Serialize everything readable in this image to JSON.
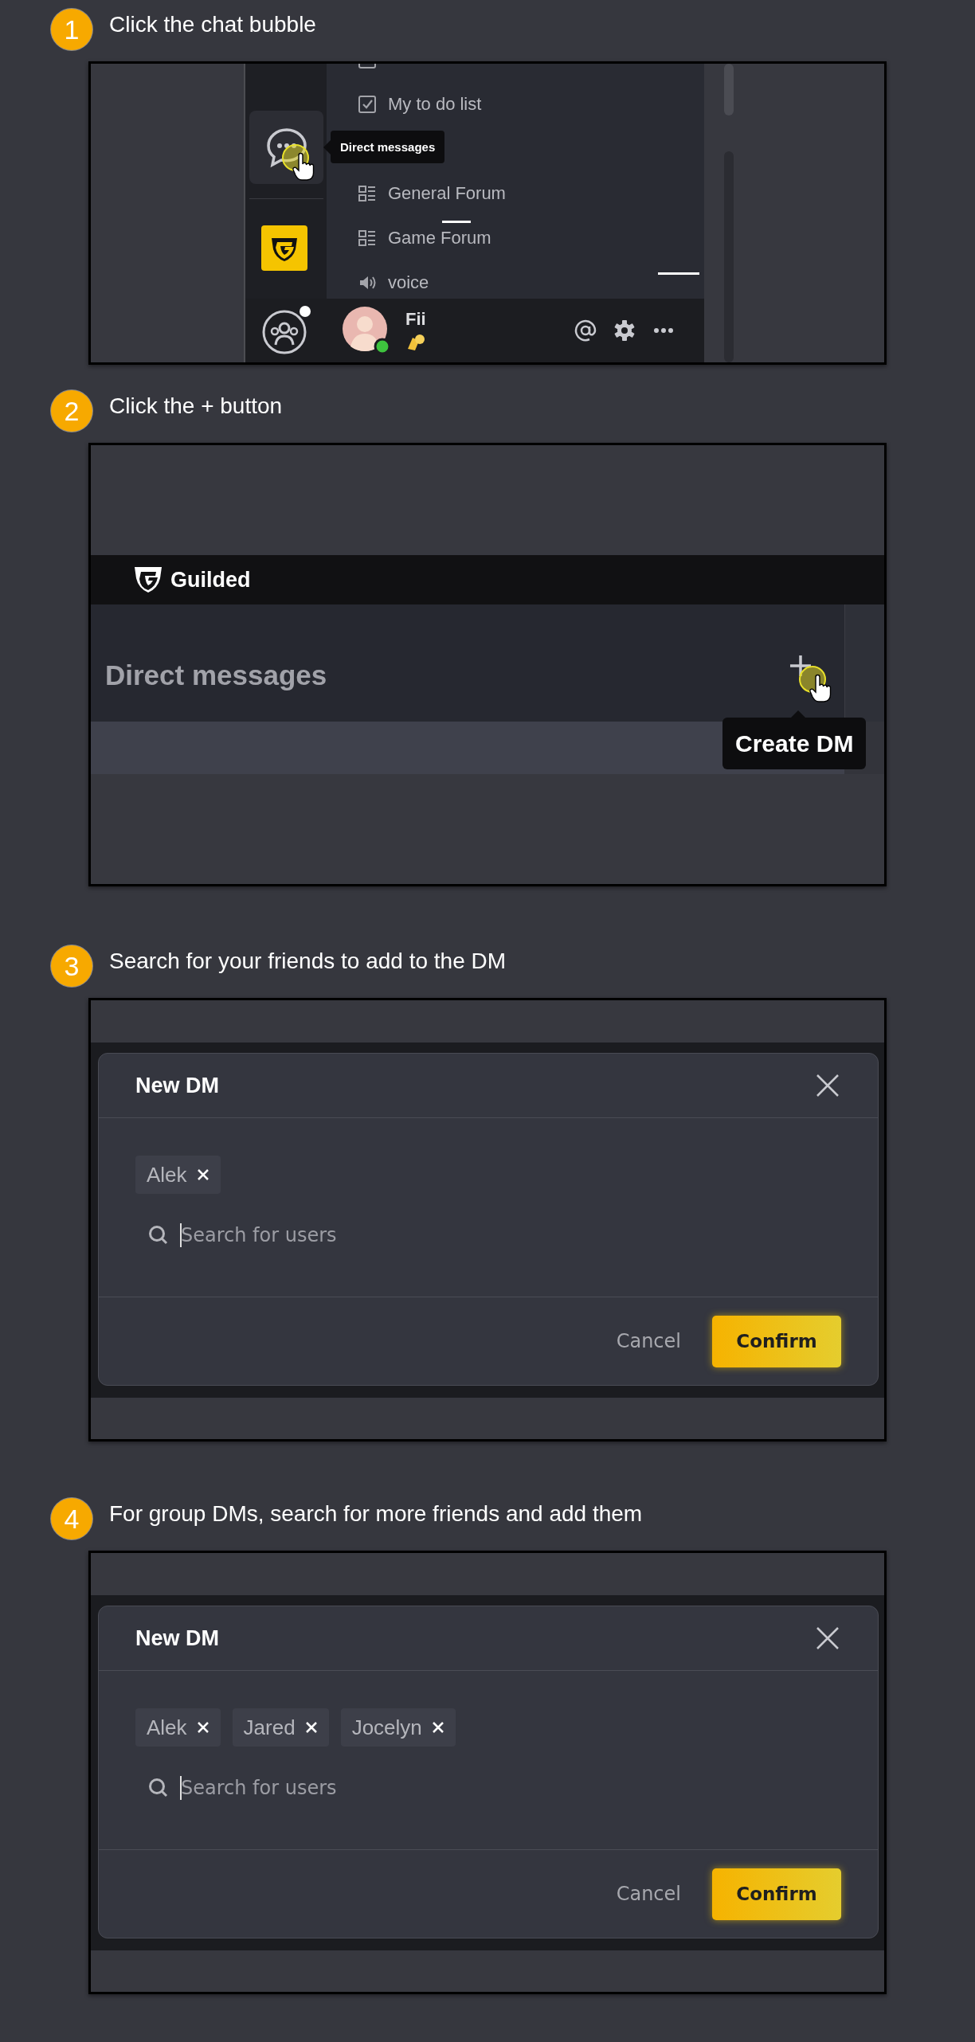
{
  "steps": [
    {
      "number": "1",
      "instruction": "Click the chat bubble",
      "screen": {
        "kind": "sidebar",
        "tooltip": "Direct messages",
        "channels": [
          {
            "kind": "checklist",
            "name": "My to do list"
          },
          {
            "kind": "forum",
            "name": "General Forum"
          },
          {
            "kind": "forum",
            "name": "Game Forum"
          },
          {
            "kind": "voice",
            "name": "voice"
          }
        ],
        "user": {
          "name": "Fii",
          "online": true
        },
        "notification": true
      }
    },
    {
      "number": "2",
      "instruction": "Click the + button",
      "screen": {
        "kind": "header",
        "brand": "Guilded",
        "section_title": "Direct messages",
        "tooltip": "Create DM"
      }
    },
    {
      "number": "3",
      "instruction": "Search for your friends to add to the DM",
      "screen": {
        "kind": "dialog",
        "title": "New DM",
        "chips": [
          "Alek"
        ],
        "search": {
          "placeholder": "Search for users"
        },
        "buttons": [
          {
            "label": "Cancel",
            "kind": "secondary"
          },
          {
            "label": "Confirm",
            "kind": "primary"
          }
        ]
      }
    },
    {
      "number": "4",
      "instruction": "For group DMs, search for more friends and add them",
      "screen": {
        "kind": "dialog",
        "title": "New DM",
        "chips": [
          "Alek",
          "Jared",
          "Jocelyn"
        ],
        "search": {
          "placeholder": "Search for users"
        },
        "buttons": [
          {
            "label": "Cancel",
            "kind": "secondary"
          },
          {
            "label": "Confirm",
            "kind": "primary"
          }
        ]
      }
    }
  ]
}
